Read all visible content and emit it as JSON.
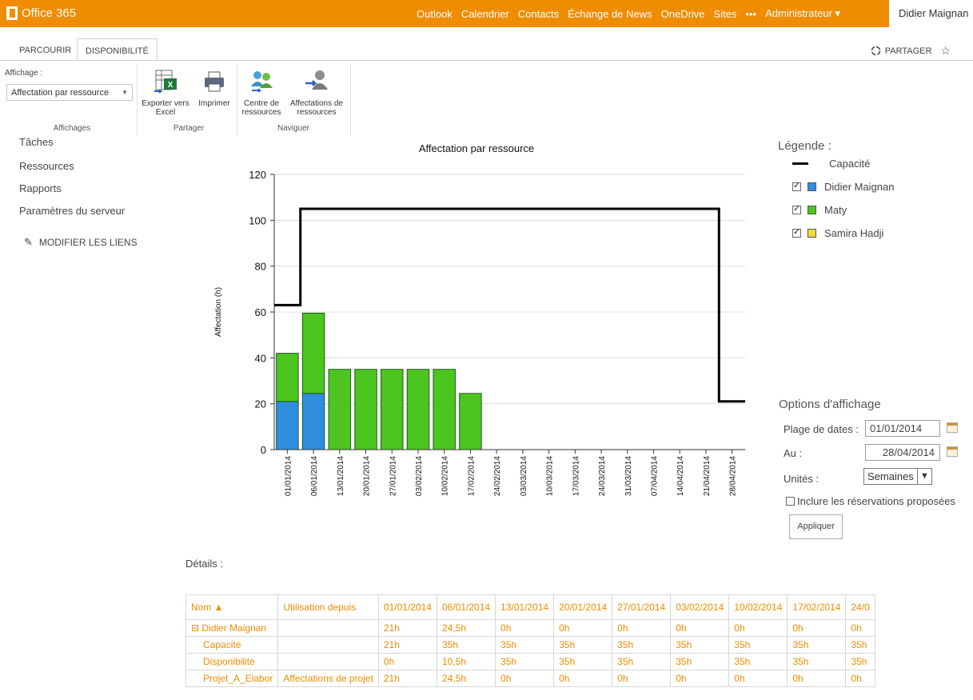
{
  "suitebar": {
    "brand": "Office 365",
    "nav": [
      "Outlook",
      "Calendrier",
      "Contacts",
      "Échange de News",
      "OneDrive",
      "Sites",
      "•••",
      "Administrateur ▾"
    ],
    "user": "Didier Maignan"
  },
  "tabs": {
    "browse": "PARCOURIR",
    "availability": "DISPONIBILITÉ"
  },
  "share": "PARTAGER",
  "ribbon": {
    "view_label": "Affichage :",
    "view_value": "Affectation par ressource",
    "export_label_1": "Exporter vers",
    "export_label_2": "Excel",
    "print_label": "Imprimer",
    "center_label_1": "Centre de",
    "center_label_2": "ressources",
    "assign_label_1": "Affectations de",
    "assign_label_2": "ressources",
    "group_views": "Affichages",
    "group_share": "Partager",
    "group_nav": "Naviguer"
  },
  "leftnav": {
    "items": [
      "Tâches",
      "Ressources",
      "Rapports",
      "Paramètres du serveur"
    ],
    "edit_links": "MODIFIER LES LIENS"
  },
  "legend": {
    "title": "Légende :",
    "capacity": "Capacité",
    "items": [
      {
        "name": "Didier Maignan",
        "color": "#2f8ee0",
        "checked": true
      },
      {
        "name": "Maty",
        "color": "#4cc51e",
        "checked": true
      },
      {
        "name": "Samira Hadji",
        "color": "#f3dd3a",
        "checked": true
      }
    ]
  },
  "options": {
    "title": "Options d'affichage",
    "date_range_label": "Plage de dates :",
    "date_from": "01/01/2014",
    "to_label": "Au :",
    "date_to": "28/04/2014",
    "units_label": "Unités :",
    "units_value": "Semaines",
    "include_label": "Inclure les réservations proposées",
    "apply": "Appliquer"
  },
  "chart_data": {
    "type": "bar",
    "title": "Affectation par ressource",
    "xlabel": "",
    "ylabel": "Affectation (h)",
    "ylim": [
      0,
      120
    ],
    "yticks": [
      0,
      20,
      40,
      60,
      80,
      100,
      120
    ],
    "categories": [
      "01/01/2014",
      "06/01/2014",
      "13/01/2014",
      "20/01/2014",
      "27/01/2014",
      "03/02/2014",
      "10/02/2014",
      "17/02/2014",
      "24/02/2014",
      "03/03/2014",
      "10/03/2014",
      "17/03/2014",
      "24/03/2014",
      "31/03/2014",
      "07/04/2014",
      "14/04/2014",
      "21/04/2014",
      "28/04/2014"
    ],
    "stacked": true,
    "series": [
      {
        "name": "Didier Maignan",
        "color": "#2f8ee0",
        "values": [
          21,
          24.5,
          0,
          0,
          0,
          0,
          0,
          0,
          0,
          0,
          0,
          0,
          0,
          0,
          0,
          0,
          0,
          0
        ]
      },
      {
        "name": "Maty",
        "color": "#4cc51e",
        "values": [
          21,
          35,
          35,
          35,
          35,
          35,
          35,
          24.5,
          0,
          0,
          0,
          0,
          0,
          0,
          0,
          0,
          0,
          0
        ]
      },
      {
        "name": "Samira Hadji",
        "color": "#f3dd3a",
        "values": [
          0,
          0,
          0,
          0,
          0,
          0,
          0,
          0,
          0,
          0,
          0,
          0,
          0,
          0,
          0,
          0,
          0,
          0
        ]
      }
    ],
    "capacity": {
      "name": "Capacité",
      "color": "#000000",
      "values": [
        63,
        105,
        105,
        105,
        105,
        105,
        105,
        105,
        105,
        105,
        105,
        105,
        105,
        105,
        105,
        105,
        105,
        21
      ]
    },
    "grid": true,
    "legend_position": "right"
  },
  "details": {
    "title": "Détails :",
    "columns": [
      "Nom ▲",
      "Utilisation depuis",
      "01/01/2014",
      "06/01/2014",
      "13/01/2014",
      "20/01/2014",
      "27/01/2014",
      "03/02/2014",
      "10/02/2014",
      "17/02/2014",
      "24/0"
    ],
    "rows": [
      [
        "⊟ Didier Maignan",
        "",
        "21h",
        "24,5h",
        "0h",
        "0h",
        "0h",
        "0h",
        "0h",
        "0h",
        "0h"
      ],
      [
        "Capacité",
        "",
        "21h",
        "35h",
        "35h",
        "35h",
        "35h",
        "35h",
        "35h",
        "35h",
        "35h"
      ],
      [
        "Disponibilité",
        "",
        "0h",
        "10,5h",
        "35h",
        "35h",
        "35h",
        "35h",
        "35h",
        "35h",
        "35h"
      ],
      [
        "Projet_A_Elabor",
        "Affectations de projet",
        "21h",
        "24,5h",
        "0h",
        "0h",
        "0h",
        "0h",
        "0h",
        "0h",
        "0h"
      ]
    ]
  }
}
